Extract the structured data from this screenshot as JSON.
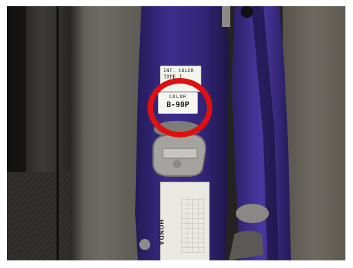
{
  "photo": {
    "subject": "door jamb paint code location",
    "colors": {
      "pillar": "#3a2c86",
      "highlight": "#e01010",
      "label": "#f4f4ef"
    }
  },
  "paint_label": {
    "line1": "INT. COLOR",
    "line2": "TYPE  I"
  },
  "color_label": {
    "heading": "COLOR",
    "code": "B-90P"
  },
  "vin_plate": {
    "brand": "HONDA"
  }
}
